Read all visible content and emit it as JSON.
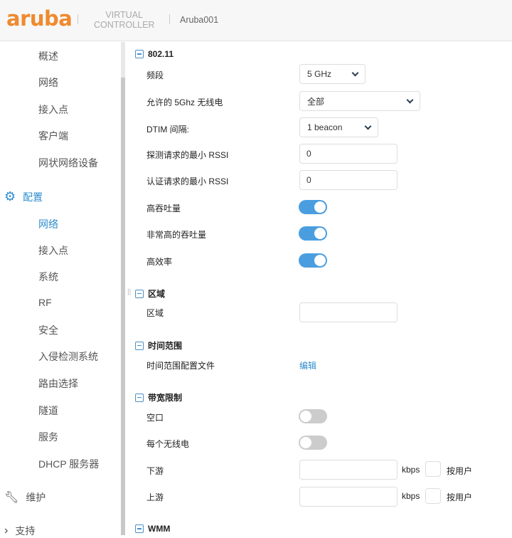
{
  "header": {
    "logo": "aruba",
    "product_line1": "VIRTUAL",
    "product_line2": "CONTROLLER",
    "host": "Aruba001"
  },
  "sidebar": {
    "monitor_items": [
      "概述",
      "网络",
      "接入点",
      "客户端",
      "网状网络设备"
    ],
    "config_label": "配置",
    "config_items": [
      "网络",
      "接入点",
      "系统",
      "RF",
      "安全",
      "入侵检测系统",
      "路由选择",
      "隧道",
      "服务",
      "DHCP 服务器"
    ],
    "maintenance_label": "维护",
    "support_label": "支持"
  },
  "sections": {
    "s80211": {
      "title": "802.11",
      "band_label": "频段",
      "band_value": "5 GHz",
      "allowed_label": "允许的 5Ghz 无线电",
      "allowed_value": "全部",
      "dtim_label": "DTIM 间隔:",
      "dtim_value": "1 beacon",
      "probe_label": "探测请求的最小 RSSI",
      "probe_value": "0",
      "auth_label": "认证请求的最小 RSSI",
      "auth_value": "0",
      "ht_label": "高吞吐量",
      "ht_on": true,
      "vht_label": "非常高的吞吐量",
      "vht_on": true,
      "he_label": "高效率",
      "he_on": true
    },
    "region": {
      "title": "区域",
      "region_label": "区域",
      "region_value": ""
    },
    "time": {
      "title": "时间范围",
      "profile_label": "时间范围配置文件",
      "edit_link": "编辑"
    },
    "bandwidth": {
      "title": "带宽限制",
      "air_label": "空口",
      "air_on": false,
      "per_radio_label": "每个无线电",
      "per_radio_on": false,
      "down_label": "下游",
      "down_value": "",
      "up_label": "上游",
      "up_value": "",
      "unit": "kbps",
      "per_user": "按用户"
    },
    "wmm": {
      "title": "WMM"
    }
  },
  "colors": {
    "accent": "#2d8ccd",
    "brand": "#ef8a2f",
    "toggle_on": "#4a9ee0"
  }
}
